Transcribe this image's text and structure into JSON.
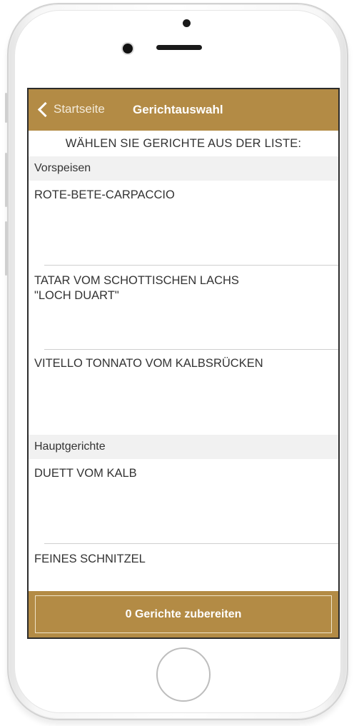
{
  "nav": {
    "back_label": "Startseite",
    "title": "Gerichtauswahl"
  },
  "heading": "WÄHLEN SIE GERICHTE AUS DER LISTE:",
  "sections": [
    {
      "name": "Vorspeisen",
      "items": [
        {
          "line1": "ROTE-BETE-CARPACCIO",
          "line2": ""
        },
        {
          "line1": "TATAR VOM SCHOTTISCHEN LACHS",
          "line2": "\"LOCH DUART\""
        },
        {
          "line1": "VITELLO TONNATO VOM KALBSRÜCKEN",
          "line2": ""
        }
      ]
    },
    {
      "name": "Hauptgerichte",
      "items": [
        {
          "line1": "DUETT VOM KALB",
          "line2": ""
        },
        {
          "line1": "FEINES SCHNITZEL",
          "line2": ""
        }
      ]
    }
  ],
  "footer": {
    "button_label": "0 Gerichte zubereiten"
  },
  "colors": {
    "accent": "#b38b45",
    "section_bg": "#f1f1f1",
    "text": "#333333"
  },
  "icons": {
    "back": "chevron-left-icon"
  }
}
